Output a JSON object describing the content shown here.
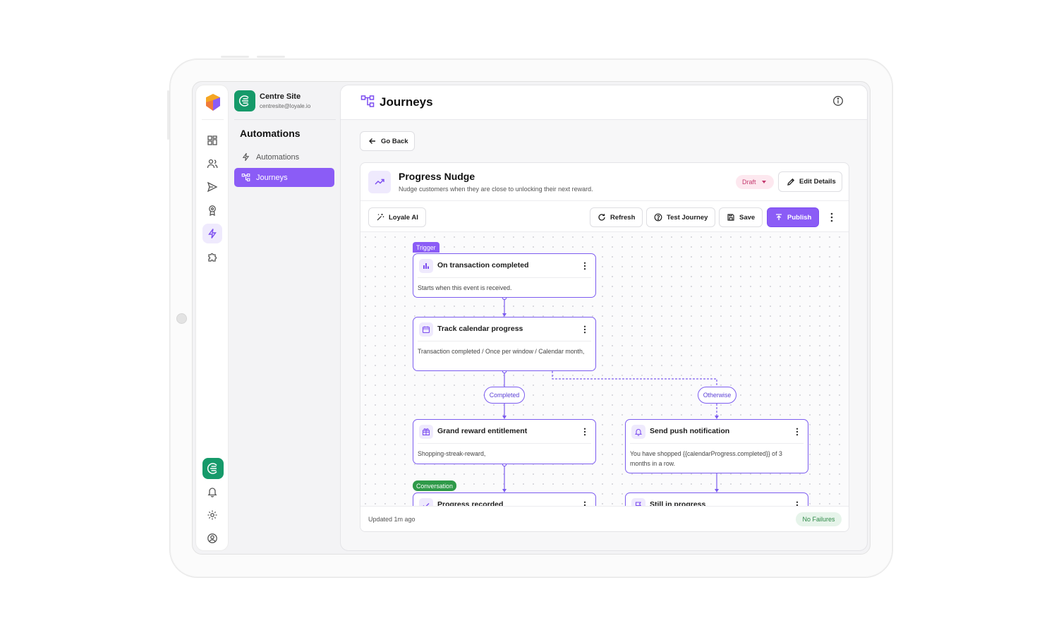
{
  "org": {
    "name": "Centre Site",
    "email": "centresite@loyale.io"
  },
  "sidebar": {
    "heading": "Automations",
    "items": [
      {
        "label": "Automations",
        "icon": "bolt-icon"
      },
      {
        "label": "Journeys",
        "icon": "journey-icon",
        "active": true
      }
    ]
  },
  "topbar": {
    "title": "Journeys"
  },
  "go_back": "Go Back",
  "journey": {
    "title": "Progress Nudge",
    "subtitle": "Nudge customers when they are close to unlocking their next reward.",
    "status": "Draft",
    "edit_label": "Edit Details"
  },
  "toolbar": {
    "ai_label": "Loyale AI",
    "refresh_label": "Refresh",
    "test_label": "Test Journey",
    "save_label": "Save",
    "publish_label": "Publish"
  },
  "nodes": {
    "trigger": {
      "tag": "Trigger",
      "title": "On transaction completed",
      "body": "Starts when this event is received."
    },
    "track": {
      "title": "Track calendar progress",
      "body": "Transaction completed / Once per window / Calendar month,"
    },
    "grand": {
      "title": "Grand reward entitlement",
      "body": "Shopping-streak-reward,"
    },
    "push": {
      "title": "Send push notification",
      "body": "You have shopped {{calendarProgress.completed}} of 3 months in a row."
    },
    "progress": {
      "tag": "Conversation",
      "title": "Progress recorded"
    },
    "still": {
      "title": "Still in progress"
    }
  },
  "branches": {
    "completed": "Completed",
    "otherwise": "Otherwise"
  },
  "footer": {
    "updated": "Updated 1m ago",
    "status": "No Failures"
  },
  "colors": {
    "accent": "#8b5cf6",
    "brand_green": "#169a6a",
    "draft": "#c43a6e",
    "success": "#2f8a48"
  }
}
